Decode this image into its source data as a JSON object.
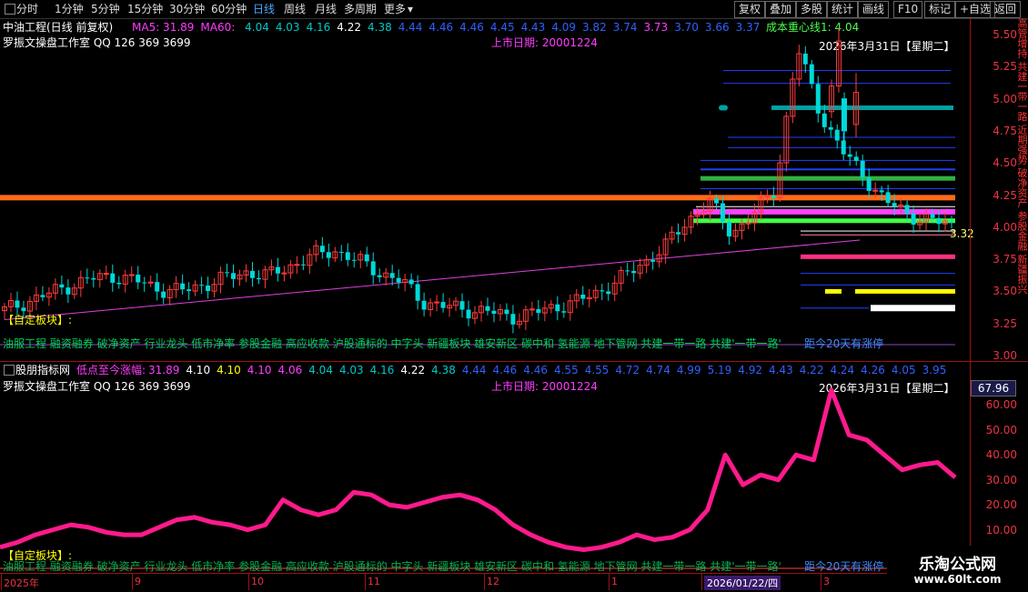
{
  "toolbar": {
    "period_tabs": [
      "分时",
      "1分钟",
      "5分钟",
      "15分钟",
      "30分钟",
      "60分钟",
      "日线",
      "周线",
      "月线",
      "多周期",
      "更多"
    ],
    "active_tab": "日线",
    "more_arrow": "▾",
    "right_buttons": [
      "复权",
      "叠加",
      "多股",
      "统计",
      "画线",
      "F10",
      "标记",
      "+自选",
      "返回"
    ]
  },
  "main_panel": {
    "stock_title": "中油工程(日线 前复权)",
    "ma_labels": [
      {
        "text": "MA5: 31.89",
        "color": "#ff3cff"
      },
      {
        "text": "MA60: ",
        "color": "#ff3cff"
      },
      {
        "text": "4.04",
        "color": "#00c8c8"
      },
      {
        "text": "4.03",
        "color": "#00c8c8"
      },
      {
        "text": "4.16",
        "color": "#00c8c8"
      },
      {
        "text": "4.22",
        "color": "#ffffff"
      },
      {
        "text": "4.38",
        "color": "#00c8c8"
      },
      {
        "text": "4.44",
        "color": "#3060ff"
      },
      {
        "text": "4.46",
        "color": "#3060ff"
      },
      {
        "text": "4.46",
        "color": "#3060ff"
      },
      {
        "text": "4.45",
        "color": "#3060ff"
      },
      {
        "text": "4.43",
        "color": "#3060ff"
      },
      {
        "text": "4.09",
        "color": "#3060ff"
      },
      {
        "text": "3.82",
        "color": "#3060ff"
      },
      {
        "text": "3.74",
        "color": "#3060ff"
      },
      {
        "text": "3.73",
        "color": "#ff3cff"
      },
      {
        "text": "3.70",
        "color": "#3060ff"
      },
      {
        "text": "3.66",
        "color": "#3060ff"
      },
      {
        "text": "3.37",
        "color": "#3060ff"
      }
    ],
    "cost_line": "成本重心线1: 4.04",
    "studio": "罗振文操盘工作室 QQ 126 369 3699",
    "listing_date": "上市日期: 20001224",
    "date_label": "2026年3月31日【星期二】",
    "custom_sector": "【自定板块】:",
    "sector_line": "油服工程 融资融券 破净资产 行业龙头 低市净率 参股金融 高应收款 沪股通标的 中字头 新疆板块 雄安新区 碳中和 氢能源 地下管网 共建一带一路 共建'一带一路'",
    "days_limit": "距今20天有涨停",
    "price_marker": "3.32",
    "y_axis": [
      "5.50",
      "5.25",
      "5.00",
      "4.75",
      "4.50",
      "4.25",
      "4.00",
      "3.75",
      "3.50",
      "3.25",
      "3.00"
    ]
  },
  "sub_panel": {
    "title": "股朋指标网",
    "label": "低点至今涨幅: ",
    "values": [
      {
        "text": "31.89",
        "color": "#ff3cff"
      },
      {
        "text": "4.10",
        "color": "#ffffff"
      },
      {
        "text": "4.10",
        "color": "#ffff00"
      },
      {
        "text": "4.10",
        "color": "#ff3cff"
      },
      {
        "text": "4.06",
        "color": "#ff3cff"
      },
      {
        "text": "4.04",
        "color": "#00c8c8"
      },
      {
        "text": "4.03",
        "color": "#00c8c8"
      },
      {
        "text": "4.16",
        "color": "#00c8c8"
      },
      {
        "text": "4.22",
        "color": "#ffffff"
      },
      {
        "text": "4.38",
        "color": "#00c8c8"
      },
      {
        "text": "4.44",
        "color": "#3060ff"
      },
      {
        "text": "4.46",
        "color": "#3060ff"
      },
      {
        "text": "4.46",
        "color": "#3060ff"
      },
      {
        "text": "4.55",
        "color": "#3060ff"
      },
      {
        "text": "4.55",
        "color": "#3060ff"
      },
      {
        "text": "4.72",
        "color": "#3060ff"
      },
      {
        "text": "4.74",
        "color": "#3060ff"
      },
      {
        "text": "4.99",
        "color": "#3060ff"
      },
      {
        "text": "5.19",
        "color": "#3060ff"
      },
      {
        "text": "4.92",
        "color": "#3060ff"
      },
      {
        "text": "4.43",
        "color": "#3060ff"
      },
      {
        "text": "4.22",
        "color": "#3060ff"
      },
      {
        "text": "4.24",
        "color": "#3060ff"
      },
      {
        "text": "4.26",
        "color": "#3060ff"
      },
      {
        "text": "4.05",
        "color": "#3060ff"
      },
      {
        "text": "3.95",
        "color": "#3060ff"
      }
    ],
    "studio": "罗振文操盘工作室 QQ 126 369 3699",
    "listing_date": "上市日期: 20001224",
    "date_label": "2026年3月31日【星期二】",
    "current_value": "67.96",
    "custom_sector": "【自定板块】:",
    "y_axis": [
      "60.00",
      "50.00",
      "40.00",
      "30.00",
      "20.00",
      "10.00"
    ]
  },
  "x_axis": {
    "labels": [
      "2025年",
      "9",
      "10",
      "11",
      "12",
      "1",
      "2026/01/22/四",
      "3"
    ]
  },
  "right_strip_text": "高管增持 共建一带一路 近期强势 破净资产 参股金融 新疆振兴",
  "watermark": {
    "title": "乐淘公式网",
    "url": "www.60lt.com"
  },
  "chart_data": [
    {
      "type": "candlestick",
      "title": "中油工程(日线 前复权)",
      "ylim": [
        3.0,
        5.55
      ],
      "x": [
        "2025年",
        "9",
        "10",
        "11",
        "12",
        "1",
        "2026/01/22/四",
        "3"
      ],
      "close_approx": [
        3.35,
        3.42,
        3.48,
        3.55,
        3.6,
        3.62,
        3.58,
        3.52,
        3.5,
        3.55,
        3.6,
        3.65,
        3.62,
        3.7,
        3.78,
        3.82,
        3.74,
        3.65,
        3.58,
        3.42,
        3.38,
        3.36,
        3.34,
        3.3,
        3.33,
        3.38,
        3.42,
        3.5,
        3.6,
        3.72,
        3.85,
        4.05,
        4.2,
        3.95,
        4.1,
        4.3,
        5.4,
        4.9,
        4.6,
        4.4,
        4.2,
        4.1,
        4.05,
        4.02
      ],
      "series": [
        {
          "name": "成本重心线1",
          "values": [
            4.04
          ]
        }
      ]
    },
    {
      "type": "line",
      "title": "股朋指标网",
      "ylim": [
        0,
        70
      ],
      "series": [
        {
          "name": "低点至今涨幅",
          "values": [
            3,
            5,
            8,
            10,
            12,
            11,
            9,
            8,
            8,
            11,
            14,
            15,
            13,
            12,
            10,
            12,
            22,
            18,
            16,
            18,
            25,
            24,
            20,
            19,
            21,
            23,
            24,
            22,
            18,
            12,
            8,
            5,
            3,
            2,
            3,
            5,
            8,
            6,
            7,
            10,
            18,
            40,
            28,
            32,
            30,
            40,
            38,
            66,
            48,
            46,
            40,
            34,
            36,
            37,
            31
          ]
        }
      ]
    }
  ]
}
